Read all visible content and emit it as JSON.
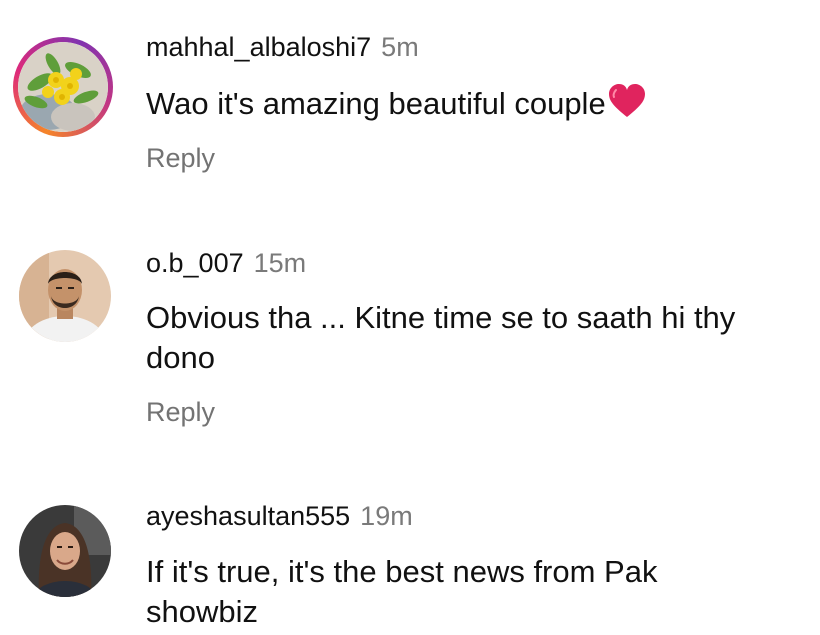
{
  "comments": [
    {
      "username": "mahhal_albaloshi7",
      "time": "5m",
      "text": "Wao it's amazing  beautiful couple",
      "emoji": "red-heart-emoji",
      "reply_label": "Reply",
      "avatar": "flower-photo-avatar",
      "has_story_ring": true
    },
    {
      "username": "o.b_007",
      "time": "15m",
      "text": "Obvious tha ... Kitne time se to saath hi thy dono",
      "reply_label": "Reply",
      "avatar": "man-photo-avatar",
      "has_story_ring": false
    },
    {
      "username": "ayeshasultan555",
      "time": "19m",
      "text": "If it's true, it's the best news from Pak showbiz",
      "avatar": "woman-photo-avatar",
      "has_story_ring": false
    }
  ],
  "colors": {
    "text": "#111111",
    "secondary": "#737373",
    "time": "#7a7a7a",
    "heart": "#e0245e"
  }
}
